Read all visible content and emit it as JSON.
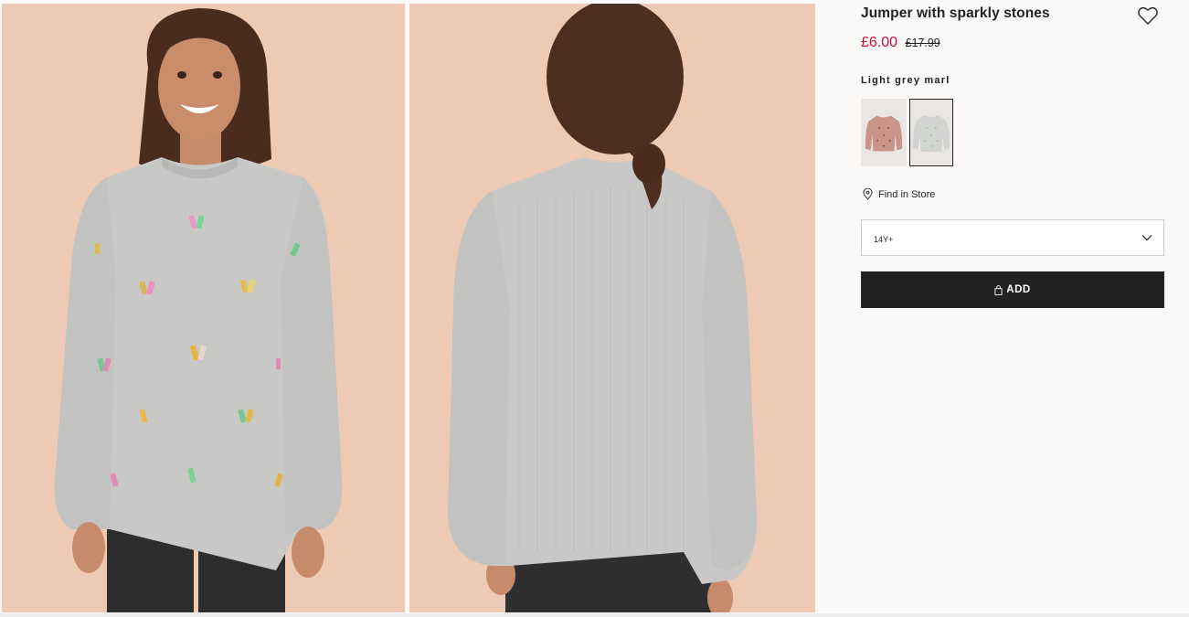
{
  "gallery": {
    "images": [
      {
        "alt": "front-view"
      },
      {
        "alt": "back-view"
      }
    ]
  },
  "product": {
    "title": "Jumper with sparkly stones",
    "price_sale": "£6.00",
    "price_original": "£17.99",
    "color_label": "Light grey marl",
    "swatches": [
      {
        "color": "#c9958a",
        "selected": false
      },
      {
        "color": "#d8dad8",
        "selected": true
      }
    ],
    "find_in_store": "Find in Store",
    "size": {
      "selected": "14Y+"
    },
    "add_button": "ADD"
  },
  "colors": {
    "sale": "#c60d3a",
    "button_bg": "#222222",
    "image_bg": "#eec9b4",
    "sweater": "#c8c9c7"
  },
  "icons": [
    "heart-icon",
    "location-pin-icon",
    "chevron-down-icon",
    "shopping-bag-icon"
  ]
}
